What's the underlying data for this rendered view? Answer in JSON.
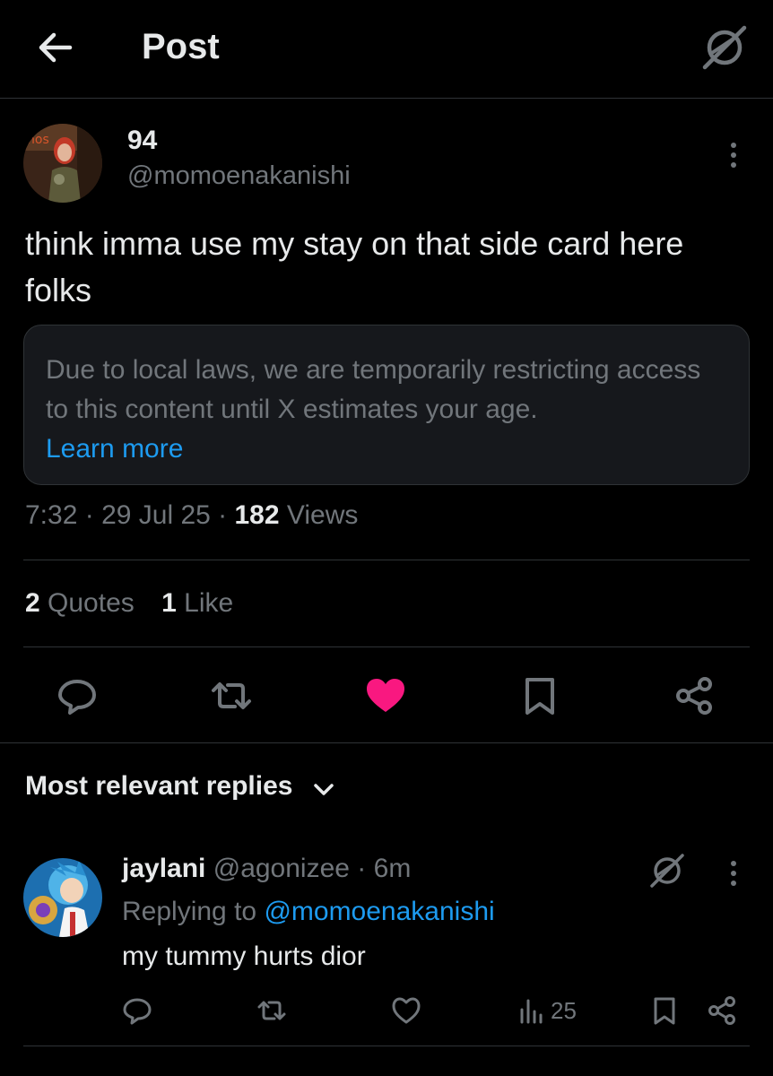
{
  "header": {
    "title": "Post",
    "icons": {
      "back": "arrow-left-icon",
      "grok": "grok-icon"
    }
  },
  "post": {
    "display_name": "94",
    "handle": "@momoenakanishi",
    "text": "think imma use my stay on that side card here folks",
    "notice": {
      "text": "Due to local laws, we are temporarily restricting access to this content until X estimates your age.",
      "link": "Learn more"
    },
    "time": "7:32",
    "date": "29 Jul 25",
    "views_count": "182",
    "views_label": "Views",
    "quotes_count": "2",
    "quotes_label": "Quotes",
    "likes_count": "1",
    "likes_label": "Like",
    "liked": true,
    "colors": {
      "like": "#f91880",
      "link": "#1d9bf0",
      "muted": "#71767b"
    }
  },
  "replies_section": {
    "label": "Most relevant replies"
  },
  "reply": {
    "display_name": "jaylani",
    "handle": "@agonizee",
    "time": "6m",
    "replying_prefix": "Replying to",
    "replying_to": "@momoenakanishi",
    "text": "my tummy hurts dior",
    "views": "25"
  }
}
